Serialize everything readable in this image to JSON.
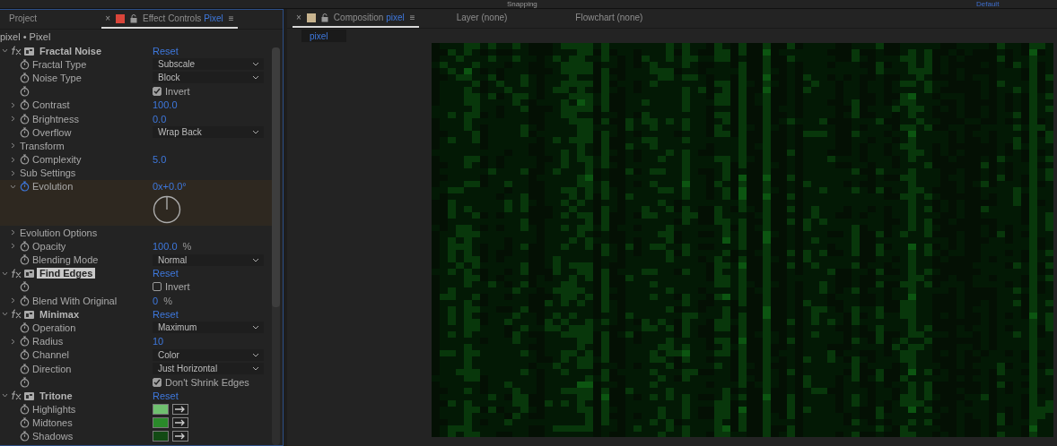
{
  "toolbar": {
    "snapping": "Snapping",
    "workspace": "Default"
  },
  "left_panel": {
    "tabs": [
      {
        "kind": "plain",
        "label": "Project",
        "selected": false
      },
      {
        "kind": "effect",
        "label": "Effect Controls",
        "layer": "Pixel",
        "close": "×",
        "menu": "≡",
        "selected": true
      }
    ],
    "breadcrumb": "pixel • Pixel",
    "effects": [
      {
        "name": "Fractal Noise",
        "reset": "Reset",
        "expanded": true,
        "selected": false,
        "rows": [
          {
            "kind": "dropdown",
            "label": "Fractal Type",
            "value": "Subscale"
          },
          {
            "kind": "dropdown",
            "label": "Noise Type",
            "value": "Block"
          },
          {
            "kind": "checkbox",
            "value": "Invert",
            "checked": true
          },
          {
            "kind": "number",
            "label": "Contrast",
            "value": "100.0",
            "expanded": false
          },
          {
            "kind": "number",
            "label": "Brightness",
            "value": "0.0",
            "expanded": false
          },
          {
            "kind": "dropdown",
            "label": "Overflow",
            "value": "Wrap Back"
          },
          {
            "kind": "group",
            "label": "Transform",
            "expanded": false
          },
          {
            "kind": "number",
            "label": "Complexity",
            "value": "5.0",
            "expanded": false
          },
          {
            "kind": "group",
            "label": "Sub Settings",
            "expanded": false
          },
          {
            "kind": "angle",
            "label": "Evolution",
            "value": "0x+0.0°",
            "expanded": true
          },
          {
            "kind": "dial"
          },
          {
            "kind": "group",
            "label": "Evolution Options",
            "expanded": false
          },
          {
            "kind": "number",
            "label": "Opacity",
            "value": "100.0",
            "unit": "%",
            "expanded": false
          },
          {
            "kind": "dropdown",
            "label": "Blending Mode",
            "value": "Normal"
          }
        ]
      },
      {
        "name": "Find Edges",
        "reset": "Reset",
        "expanded": true,
        "selected": true,
        "rows": [
          {
            "kind": "checkbox",
            "value": "Invert",
            "checked": false
          },
          {
            "kind": "number",
            "label": "Blend With Original",
            "value": "0",
            "unit": "%",
            "expanded": false
          }
        ]
      },
      {
        "name": "Minimax",
        "reset": "Reset",
        "expanded": true,
        "selected": false,
        "rows": [
          {
            "kind": "dropdown",
            "label": "Operation",
            "value": "Maximum"
          },
          {
            "kind": "number",
            "label": "Radius",
            "value": "10",
            "expanded": false
          },
          {
            "kind": "dropdown",
            "label": "Channel",
            "value": "Color"
          },
          {
            "kind": "dropdown",
            "label": "Direction",
            "value": "Just Horizontal"
          },
          {
            "kind": "checkbox",
            "value": "Don't Shrink Edges",
            "checked": true
          }
        ]
      },
      {
        "name": "Tritone",
        "reset": "Reset",
        "expanded": true,
        "selected": false,
        "rows": [
          {
            "kind": "color",
            "label": "Highlights",
            "color": "#6fc06f"
          },
          {
            "kind": "color",
            "label": "Midtones",
            "color": "#2a8a2a"
          },
          {
            "kind": "color",
            "label": "Shadows",
            "color": "#124a14"
          }
        ]
      }
    ]
  },
  "right_panel": {
    "tabs": [
      {
        "kind": "comp",
        "label": "Composition",
        "comp": "pixel",
        "close": "×",
        "menu": "≡",
        "selected": true
      },
      {
        "kind": "plain",
        "label": "Layer (none)",
        "selected": false
      },
      {
        "kind": "plain",
        "label": "Flowchart (none)",
        "selected": false
      }
    ],
    "subtabs": [
      {
        "label": "pixel"
      }
    ]
  }
}
